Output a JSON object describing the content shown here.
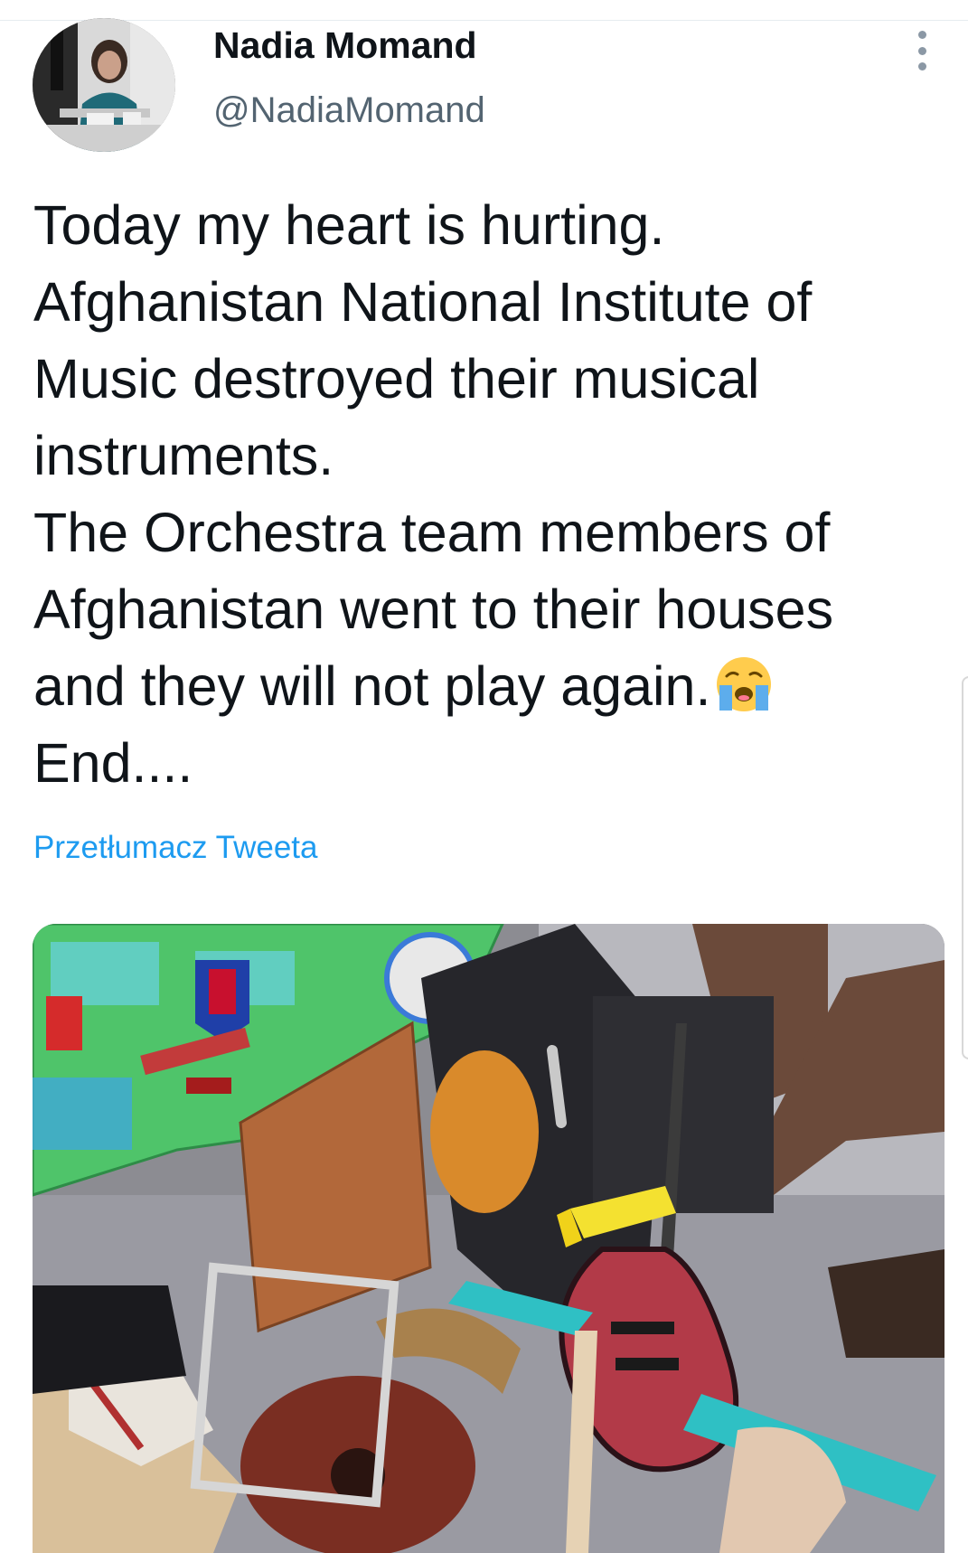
{
  "tweet": {
    "author": {
      "display_name": "Nadia Momand",
      "handle": "@NadiaMomand"
    },
    "text_lines": [
      "Today my heart is hurting.",
      "Afghanistan National Institute of",
      "Music destroyed their musical",
      "instruments.",
      "The Orchestra team members of",
      "Afghanistan went to their houses",
      "and they will not play again.",
      "End...."
    ],
    "emoji": "loudly-crying-face",
    "translate_label": "Przetłumacz Tweeta",
    "media": {
      "description_icons": "photo"
    }
  },
  "icons": {
    "more": "more-vertical-icon",
    "emoji": "loudly-crying-face-icon"
  },
  "colors": {
    "link": "#1d9bf0",
    "text": "#0f1419",
    "secondary": "#536471"
  }
}
